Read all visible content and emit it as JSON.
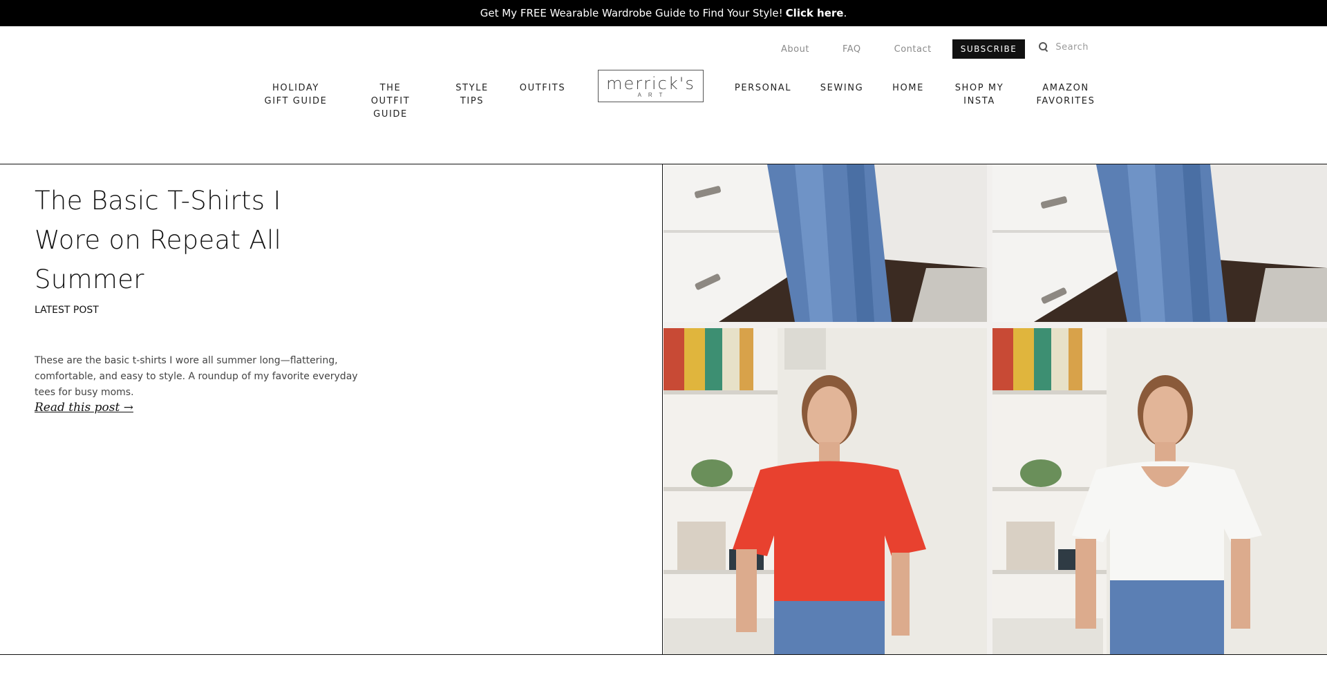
{
  "announcement": {
    "text": "Get My FREE Wearable Wardrobe Guide to Find Your Style!",
    "cta": "Click here",
    "period": "."
  },
  "utility_nav": {
    "links": [
      "About",
      "FAQ",
      "Contact"
    ],
    "subscribe_label": "SUBSCRIBE",
    "search_placeholder": "Search"
  },
  "logo": {
    "main": "merrick's",
    "sub": "ART"
  },
  "main_nav": {
    "left": [
      "HOLIDAY\nGIFT GUIDE",
      "THE\nOUTFIT\nGUIDE",
      "STYLE\nTIPS",
      "OUTFITS"
    ],
    "right": [
      "PERSONAL",
      "SEWING",
      "HOME",
      "SHOP MY\nINSTA",
      "AMAZON\nFAVORITES"
    ]
  },
  "featured_post": {
    "title": "The Basic T-Shirts I Wore on Repeat All Summer",
    "label": "LATEST POST",
    "excerpt": "These are the basic t-shirts I wore all summer long—flattering, comfortable, and easy to style. A roundup of my favorite everyday tees for busy moms.",
    "read_more": "Read this post →"
  },
  "colors": {
    "topbar_bg": "#000000",
    "text": "#111111",
    "muted": "#8a8a8a",
    "denim": "#5b7fb4",
    "red_tee": "#e8412f",
    "white_tee": "#f7f7f5"
  }
}
